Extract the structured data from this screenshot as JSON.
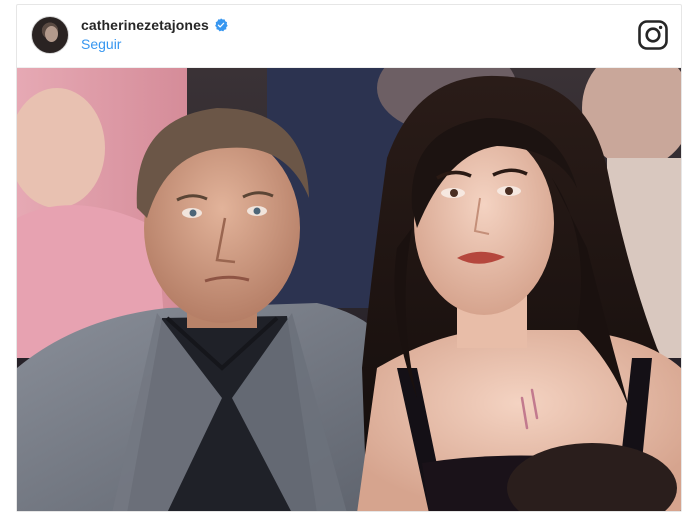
{
  "post": {
    "username": "catherinezetajones",
    "follow_label": "Seguir",
    "verified": true
  },
  "icons": {
    "verified": "verified-badge-icon",
    "platform": "instagram-icon"
  },
  "colors": {
    "link": "#3897f0",
    "verified": "#3897f0",
    "username": "#262626"
  }
}
